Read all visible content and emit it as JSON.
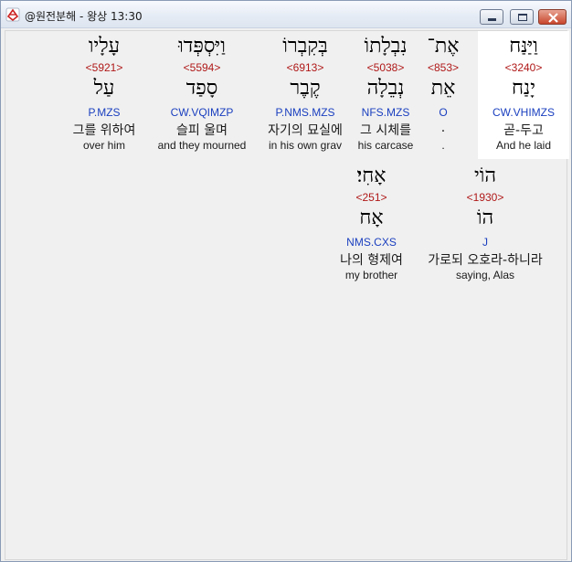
{
  "window": {
    "title": "@원전분해 - 왕상 13:30"
  },
  "words": [
    {
      "hebrew": "וַיַּנַּח",
      "strong": "<3240>",
      "lemma": "יָנַח",
      "morph": "CW.VHIMZS",
      "korean": "곧-두고",
      "english": "And he laid"
    },
    {
      "hebrew": "אֶת־",
      "strong": "<853>",
      "lemma": "אֵת",
      "morph": "O",
      "korean": ".",
      "english": "."
    },
    {
      "hebrew": "נִבְלָתוֹ",
      "strong": "<5038>",
      "lemma": "נְבֵלָה",
      "morph": "NFS.MZS",
      "korean": "그 시체를",
      "english": "his carcase"
    },
    {
      "hebrew": "בְּקִבְרוֹ",
      "strong": "<6913>",
      "lemma": "קֶבֶר",
      "morph": "P.NMS.MZS",
      "korean": "자기의 묘실에",
      "english": "in his own grav"
    },
    {
      "hebrew": "וַיִּסְפְּדוּ",
      "strong": "<5594>",
      "lemma": "סָפַד",
      "morph": "CW.VQIMZP",
      "korean": "슬피 울며",
      "english": "and they mourned"
    },
    {
      "hebrew": "עָלָיו",
      "strong": "<5921>",
      "lemma": "עַל",
      "morph": "P.MZS",
      "korean": "그를 위하여",
      "english": "over him"
    },
    {
      "hebrew": "הוֹי",
      "strong": "<1930>",
      "lemma": "הוֹ",
      "morph": "J",
      "korean": "가로되 오호라-하니라",
      "english": "saying, Alas"
    },
    {
      "hebrew": "אָחִי׃",
      "strong": "<251>",
      "lemma": "אָח",
      "morph": "NMS.CXS",
      "korean": "나의 형제여",
      "english": "my brother"
    }
  ]
}
